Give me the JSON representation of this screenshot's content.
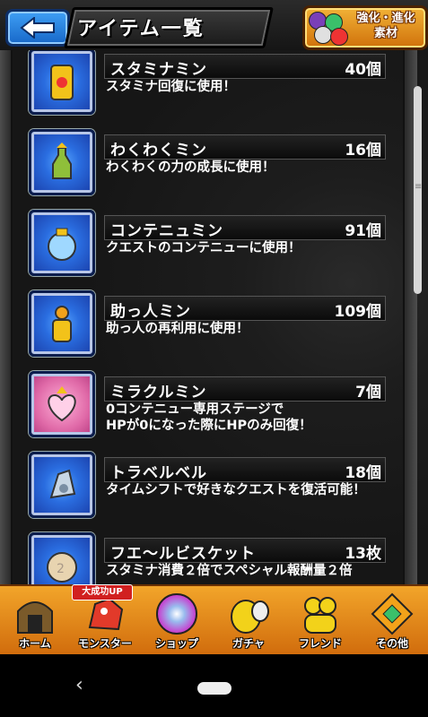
{
  "header": {
    "title": "アイテム一覧",
    "material_button": "強化・進化\n素材",
    "back_icon": "arrow-left-icon"
  },
  "items": [
    {
      "name": "スタミナミン",
      "count": "40個",
      "desc": "スタミナ回復に使用！",
      "icon": "stamina-can-icon"
    },
    {
      "name": "わくわくミン",
      "count": "16個",
      "desc": "わくわくの力の成長に使用！",
      "icon": "waku-bottle-icon"
    },
    {
      "name": "コンテニュミン",
      "count": "91個",
      "desc": "クエストのコンテニューに使用！",
      "icon": "continue-jar-icon"
    },
    {
      "name": "助っ人ミン",
      "count": "109個",
      "desc": "助っ人の再利用に使用！",
      "icon": "helper-bottle-icon"
    },
    {
      "name": "ミラクルミン",
      "count": "7個",
      "desc": "0コンテニュー専用ステージで\nHPが0になった際にHPのみ回復！",
      "icon": "miracle-heart-icon"
    },
    {
      "name": "トラベルベル",
      "count": "18個",
      "desc": "タイムシフトで好きなクエストを復活可能！",
      "icon": "travel-bell-icon"
    },
    {
      "name": "フエ～ルビスケット",
      "count": "13枚",
      "desc": "スタミナ消費２倍でスペシャル報酬量２倍",
      "icon": "biscuit-icon"
    }
  ],
  "bottom_nav": [
    {
      "label": "ホーム",
      "icon": "home-gate-icon"
    },
    {
      "label": "モンスター",
      "icon": "monster-icon",
      "badge": "大成功UP"
    },
    {
      "label": "ショップ",
      "icon": "rainbow-orb-icon"
    },
    {
      "label": "ガチャ",
      "icon": "gacha-egg-icon"
    },
    {
      "label": "フレンド",
      "icon": "friends-icon"
    },
    {
      "label": "その他",
      "icon": "other-diamond-icon"
    }
  ],
  "android": {
    "back_icon": "chevron-left-icon",
    "home_icon": "home-pill-icon"
  }
}
